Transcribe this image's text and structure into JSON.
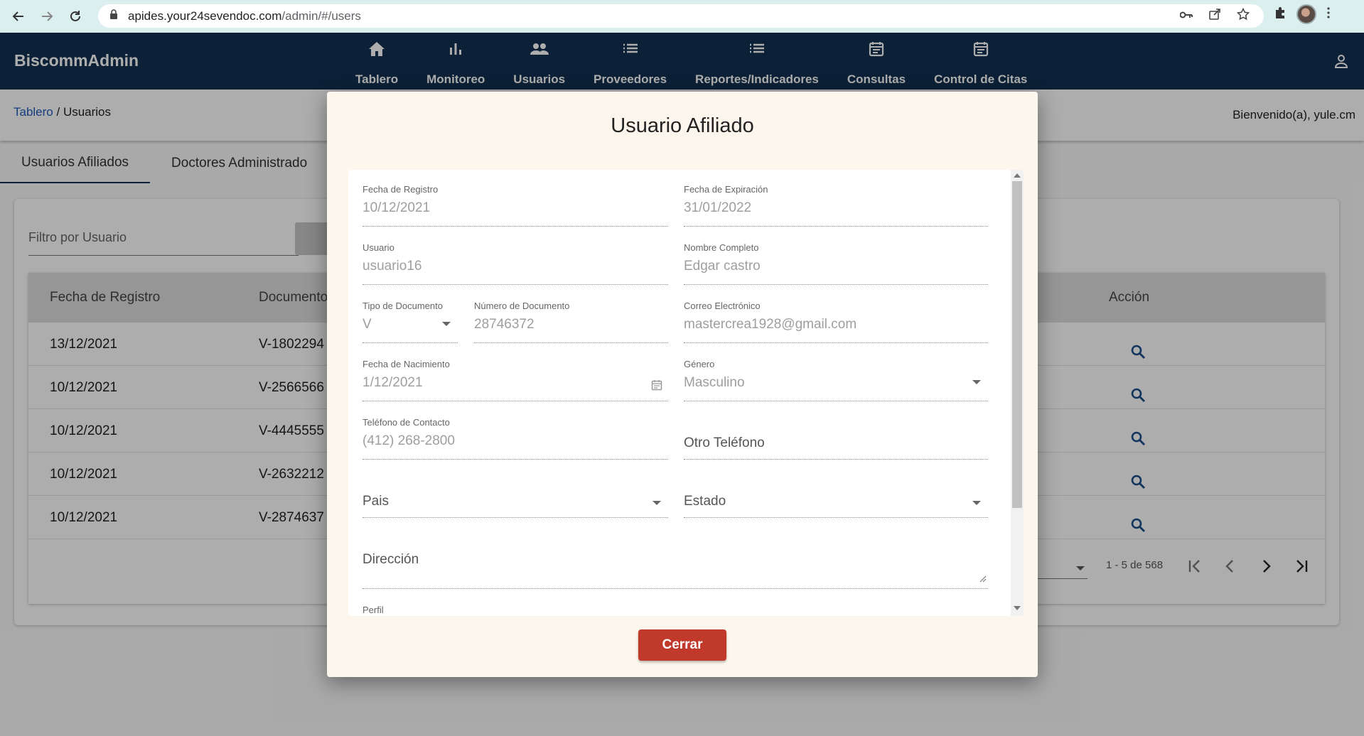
{
  "browser": {
    "url_host": "apides.your24sevendoc.com",
    "url_path": "/admin/#/users"
  },
  "app": {
    "brand": "BiscommAdmin",
    "nav": [
      {
        "label": "Tablero",
        "icon": "home-icon"
      },
      {
        "label": "Monitoreo",
        "icon": "bar-chart-icon"
      },
      {
        "label": "Usuarios",
        "icon": "people-icon"
      },
      {
        "label": "Proveedores",
        "icon": "list-icon"
      },
      {
        "label": "Reportes/Indicadores",
        "icon": "list-icon"
      },
      {
        "label": "Consultas",
        "icon": "calendar-icon"
      },
      {
        "label": "Control de Citas",
        "icon": "calendar-icon"
      }
    ]
  },
  "breadcrumb": {
    "link": "Tablero",
    "separator": " / ",
    "current": "Usuarios"
  },
  "welcome": "Bienvenido(a), yule.cm",
  "tabs": [
    "Usuarios Afiliados",
    "Doctores Administrado"
  ],
  "filter": {
    "placeholder": "Filtro por Usuario"
  },
  "table": {
    "headers": [
      "Fecha de Registro",
      "Documento",
      "Acción"
    ],
    "rows": [
      {
        "fecha": "13/12/2021",
        "documento": "V-1802294"
      },
      {
        "fecha": "10/12/2021",
        "documento": "V-2566566"
      },
      {
        "fecha": "10/12/2021",
        "documento": "V-4445555"
      },
      {
        "fecha": "10/12/2021",
        "documento": "V-2632212"
      },
      {
        "fecha": "10/12/2021",
        "documento": "V-2874637"
      }
    ],
    "range": "1 - 5 de 568"
  },
  "dialog": {
    "title": "Usuario Afiliado",
    "fields": {
      "fecha_registro": {
        "label": "Fecha de Registro",
        "value": "10/12/2021"
      },
      "fecha_expiracion": {
        "label": "Fecha de Expiración",
        "value": "31/01/2022"
      },
      "usuario": {
        "label": "Usuario",
        "value": "usuario16"
      },
      "nombre": {
        "label": "Nombre Completo",
        "value": "Edgar castro"
      },
      "tipo_doc": {
        "label": "Tipo de Documento",
        "value": "V"
      },
      "numero_doc": {
        "label": "Número de Documento",
        "value": "28746372"
      },
      "correo": {
        "label": "Correo Electrónico",
        "value": "mastercrea1928@gmail.com"
      },
      "nacimiento": {
        "label": "Fecha de Nacimiento",
        "value": "1/12/2021"
      },
      "genero": {
        "label": "Género",
        "value": "Masculino"
      },
      "telefono": {
        "label": "Teléfono de Contacto",
        "value": "(412) 268-2800"
      },
      "otro_telefono": {
        "placeholder": "Otro Teléfono"
      },
      "pais": {
        "placeholder": "Pais"
      },
      "estado": {
        "placeholder": "Estado"
      },
      "direccion": {
        "placeholder": "Dirección"
      },
      "perfil": {
        "label": "Perfil"
      }
    },
    "close_label": "Cerrar"
  },
  "colors": {
    "header": "#123152",
    "close_button": "#c0392b",
    "dialog_bg": "#fdf6ec"
  }
}
